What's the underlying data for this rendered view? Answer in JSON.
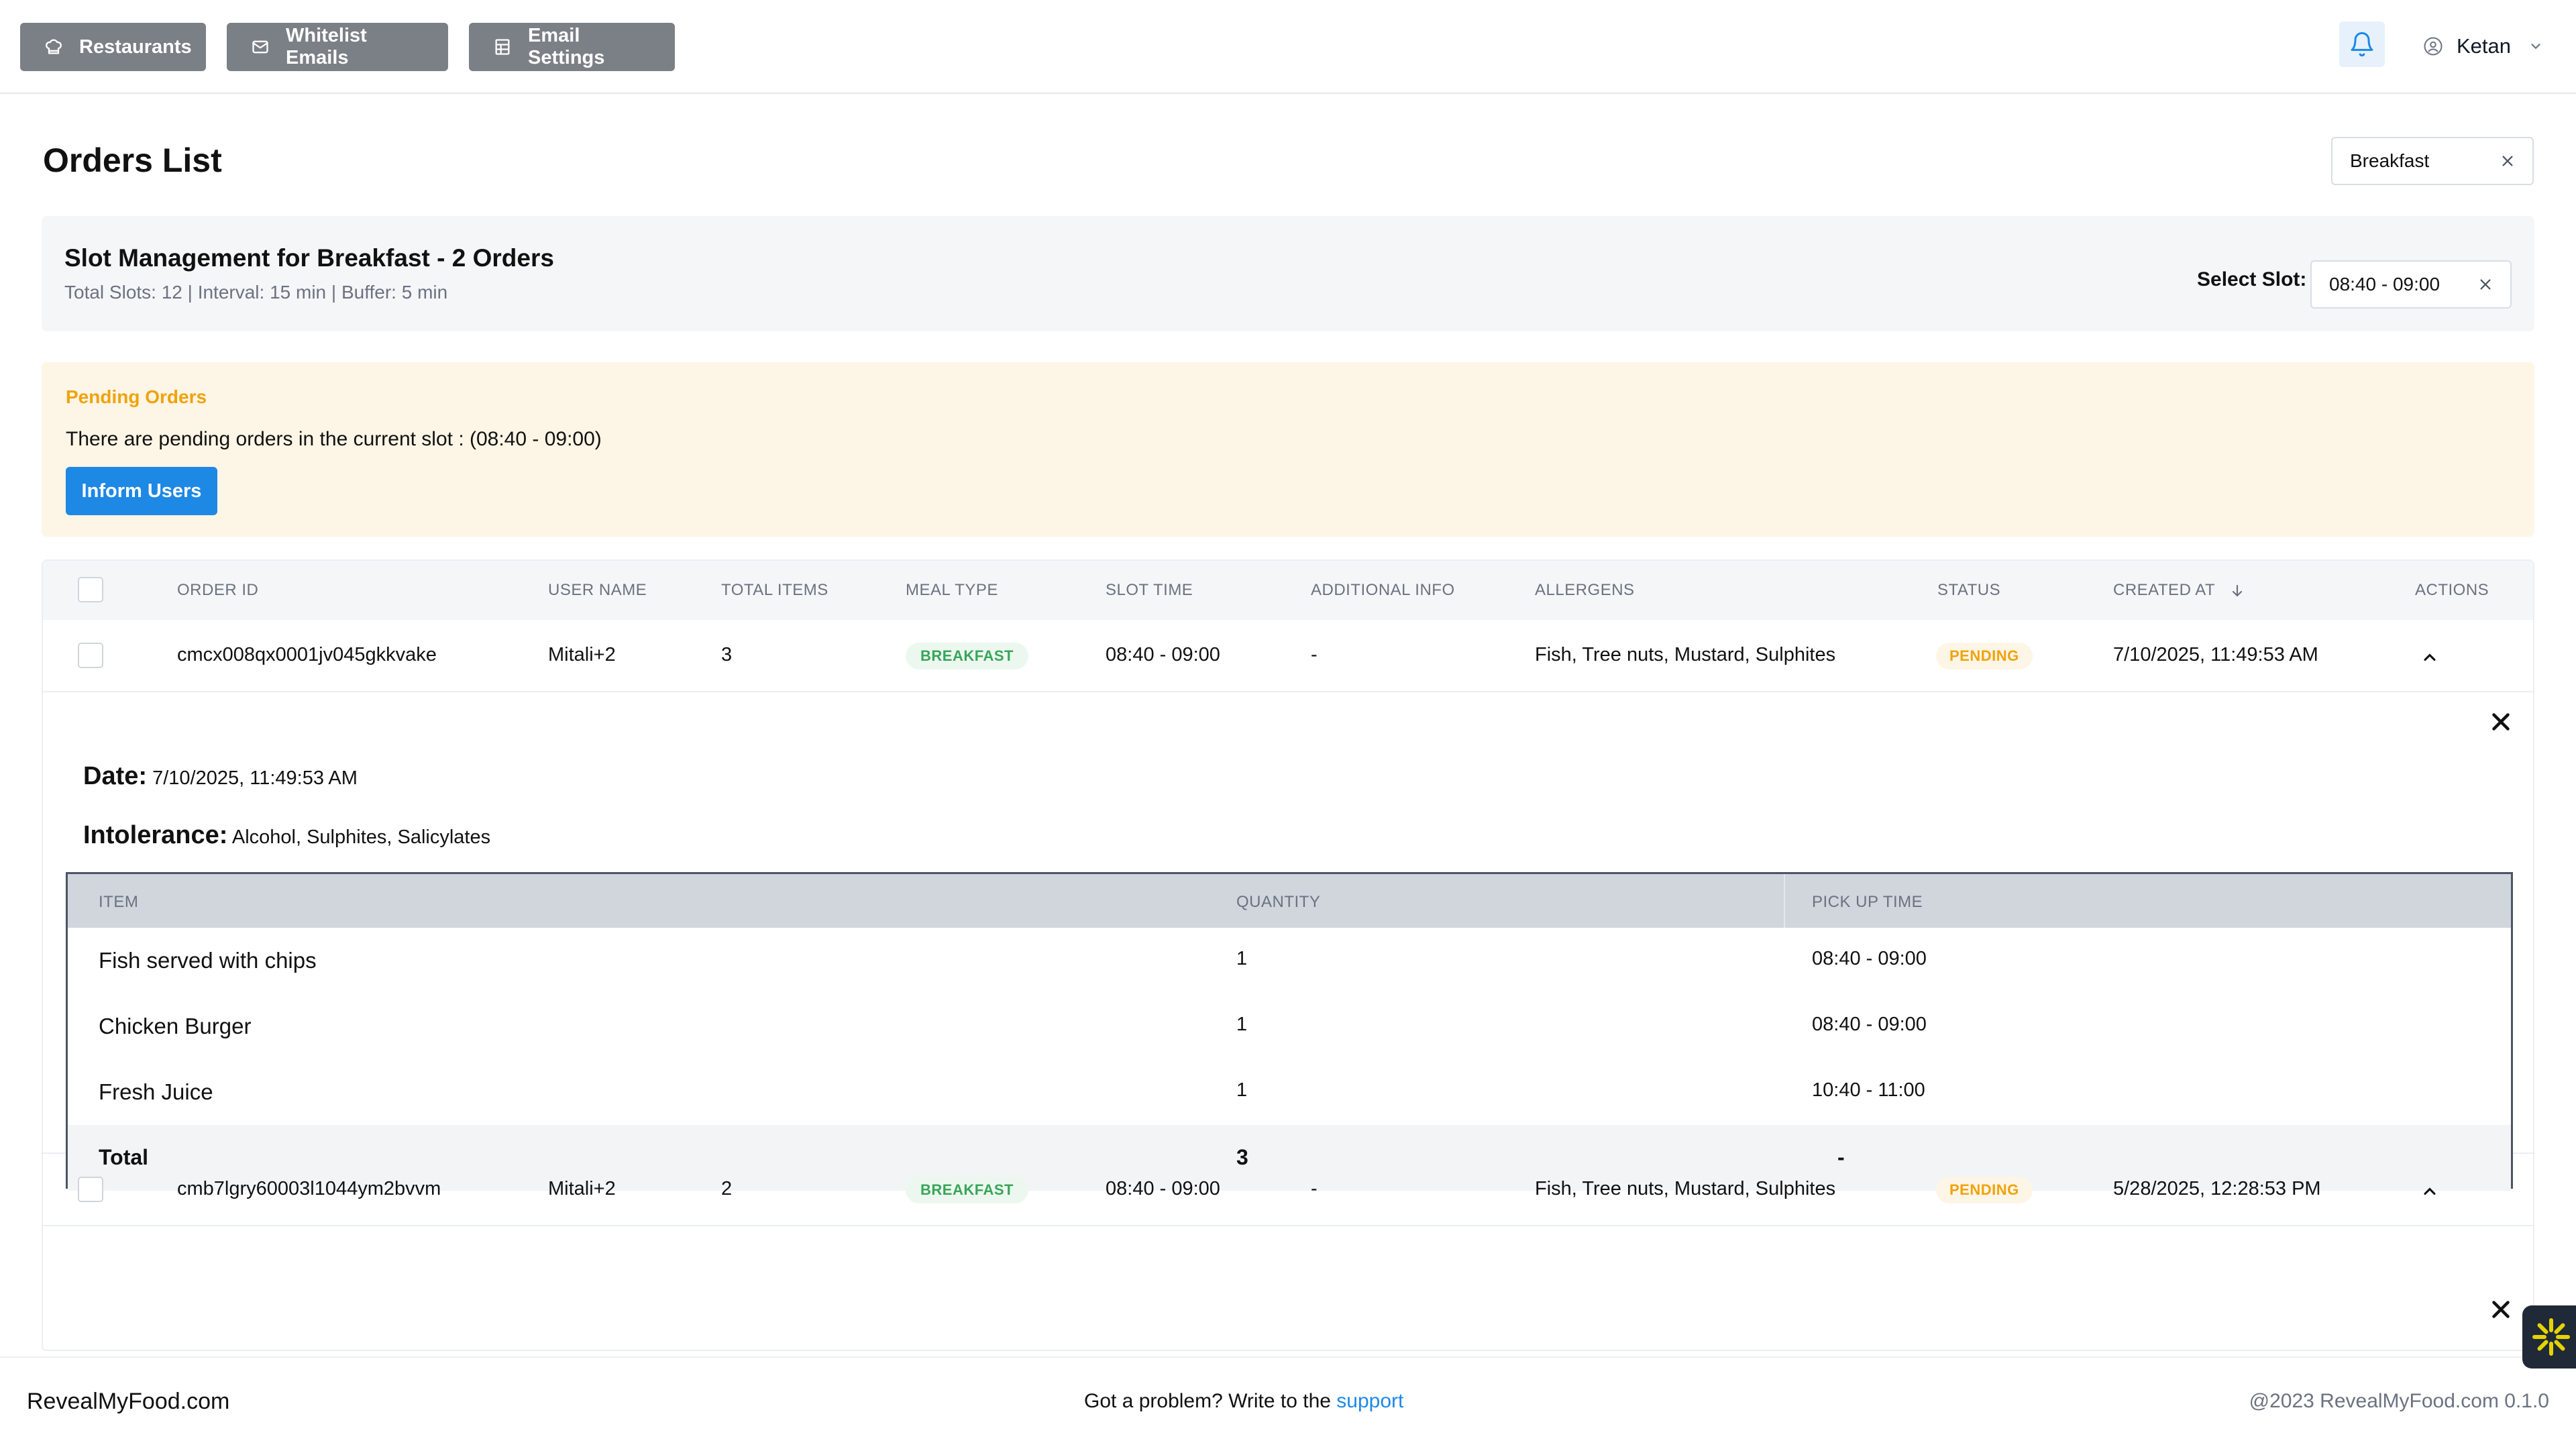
{
  "nav": {
    "buttons": [
      {
        "label": "Restaurants",
        "icon": "chef-hat-icon"
      },
      {
        "label": "Whitelist Emails",
        "icon": "mail-icon"
      },
      {
        "label": "Email Settings",
        "icon": "table-settings-icon"
      }
    ],
    "user_name": "Ketan"
  },
  "page": {
    "title": "Orders List",
    "meal_filter": "Breakfast"
  },
  "slot": {
    "title": "Slot Management for Breakfast - 2 Orders",
    "subtitle": "Total Slots: 12 | Interval: 15 min | Buffer: 5 min",
    "select_label": "Select Slot:",
    "selected": "08:40 - 09:00"
  },
  "alert": {
    "title": "Pending Orders",
    "text": "There are pending orders in the current slot : (08:40 - 09:00)",
    "button": "Inform Users"
  },
  "table": {
    "headers": [
      "Order ID",
      "User Name",
      "Total Items",
      "Meal Type",
      "Slot Time",
      "Additional Info",
      "Allergens",
      "Status",
      "Created At",
      "Actions"
    ],
    "rows": [
      {
        "order_id": "cmcx008qx0001jv045gkkvake",
        "user": "Mitali+2",
        "total_items": "3",
        "meal_type": "BREAKFAST",
        "slot_time": "08:40 - 09:00",
        "additional_info": "-",
        "allergens": "Fish, Tree nuts, Mustard, Sulphites",
        "status": "PENDING",
        "created_at": "7/10/2025, 11:49:53 AM"
      },
      {
        "order_id": "cmb7lgry60003l1044ym2bvvm",
        "user": "Mitali+2",
        "total_items": "2",
        "meal_type": "BREAKFAST",
        "slot_time": "08:40 - 09:00",
        "additional_info": "-",
        "allergens": "Fish, Tree nuts, Mustard, Sulphites",
        "status": "PENDING",
        "created_at": "5/28/2025, 12:28:53 PM"
      }
    ]
  },
  "detail": {
    "date_label": "Date:",
    "date_value": "7/10/2025, 11:49:53 AM",
    "intolerance_label": "Intolerance:",
    "intolerance_value": "Alcohol, Sulphites, Salicylates",
    "headers": [
      "Item",
      "Quantity",
      "Pick Up Time"
    ],
    "items": [
      {
        "name": "Fish served with chips",
        "qty": "1",
        "pickup": "08:40 - 09:00"
      },
      {
        "name": "Chicken Burger",
        "qty": "1",
        "pickup": "08:40 - 09:00"
      },
      {
        "name": "Fresh Juice",
        "qty": "1",
        "pickup": "10:40 - 11:00"
      }
    ],
    "total": {
      "label": "Total",
      "qty": "3",
      "pickup": "-"
    }
  },
  "footer": {
    "brand": "RevealMyFood.com",
    "problem_text": "Got a problem? Write to the ",
    "support_link": "support",
    "copyright": "@2023 RevealMyFood.com 0.1.0"
  },
  "colors": {
    "nav_button": "#7b7f86",
    "primary": "#1e88e5",
    "pending": "#f0a30a",
    "breakfast_badge": "#3aa55a",
    "alert_bg": "#fdf5e6"
  }
}
